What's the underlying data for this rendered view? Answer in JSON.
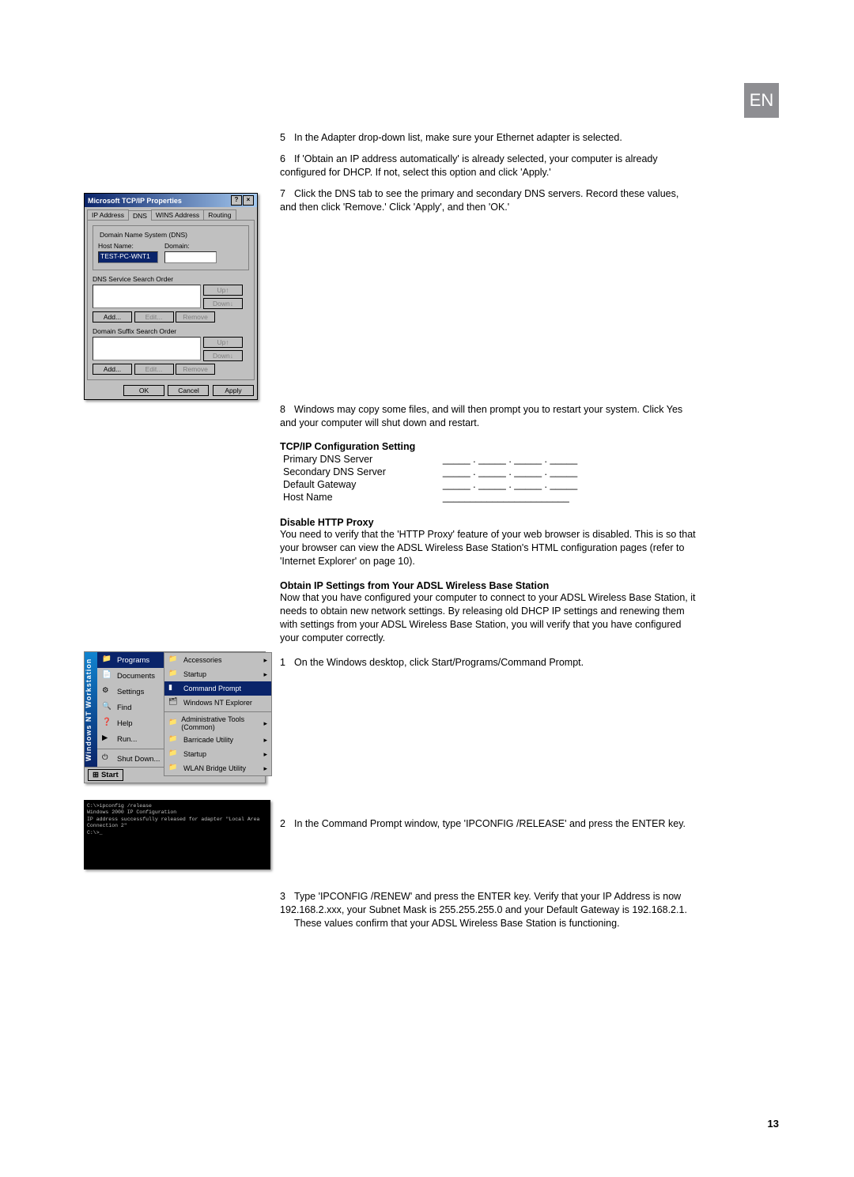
{
  "lang_tab": "EN",
  "page_number": "13",
  "steps_top": {
    "s5": "In the Adapter drop-down list, make sure your Ethernet adapter is selected.",
    "s6": "If 'Obtain an IP address automatically' is already selected, your computer is already configured for DHCP. If not, select this option and click 'Apply.'",
    "s7": "Click the DNS tab to see the primary and secondary DNS servers. Record these values, and then click 'Remove.' Click 'Apply', and then 'OK.'",
    "s8": "Windows may copy some files, and will then prompt you to restart your system. Click Yes and your computer will shut down and restart."
  },
  "tcpip_dialog": {
    "title": "Microsoft TCP/IP Properties",
    "tabs": [
      "IP Address",
      "DNS",
      "WINS Address",
      "Routing"
    ],
    "grp1": "Domain Name System (DNS)",
    "host_label": "Host Name:",
    "host_value": "TEST-PC-WNT1",
    "domain_label": "Domain:",
    "grp2": "DNS Service Search Order",
    "grp3": "Domain Suffix Search Order",
    "btn_up": "Up↑",
    "btn_down": "Down↓",
    "btn_add": "Add...",
    "btn_edit": "Edit...",
    "btn_remove": "Remove",
    "btn_ok": "OK",
    "btn_cancel": "Cancel",
    "btn_apply": "Apply"
  },
  "config_section": {
    "heading": "TCP/IP Configuration Setting",
    "rows": [
      "Primary DNS Server",
      "Secondary DNS Server",
      "Default Gateway",
      "Host Name"
    ],
    "blank": "_____ . _____ . _____ . _____",
    "blank_plain": "_______________________"
  },
  "proxy_section": {
    "heading": "Disable HTTP Proxy",
    "body": "You need to verify that the 'HTTP Proxy' feature of your web browser is disabled. This is so that your browser can view the ADSL Wireless Base Station's HTML configuration pages (refer to 'Internet Explorer' on page 10)."
  },
  "obtain_section": {
    "heading": "Obtain IP Settings from Your ADSL Wireless Base Station",
    "body": "Now that you have configured your computer to connect to your ADSL Wireless Base Station, it needs to obtain new network settings. By releasing old DHCP IP settings and renewing them with settings from your ADSL Wireless Base Station, you will verify that you have configured your computer correctly."
  },
  "steps_bottom": {
    "s1": "On the Windows desktop, click Start/Programs/Command Prompt.",
    "s2": "In the Command Prompt window, type 'IPCONFIG /RELEASE' and press the ENTER key.",
    "s3a": "Type 'IPCONFIG /RENEW' and press the ENTER key. Verify that your IP Address is now 192.168.2.xxx, your Subnet Mask is 255.255.255.0 and your Default Gateway is 192.168.2.1.",
    "s3b": "These values confirm that your ADSL Wireless Base Station is functioning."
  },
  "start_menu": {
    "side": "Windows NT Workstation",
    "items": [
      "Programs",
      "Documents",
      "Settings",
      "Find",
      "Help",
      "Run...",
      "Shut Down..."
    ],
    "sub_top": [
      "Accessories",
      "Startup",
      "Command Prompt",
      "Windows NT Explorer"
    ],
    "sub_bottom": [
      "Administrative Tools (Common)",
      "Barricade Utility",
      "Startup",
      "WLAN Bridge Utility"
    ],
    "start_btn": "Start"
  },
  "cmd_lines": [
    "C:\\>ipconfig /release",
    "",
    "Windows 2000 IP Configuration",
    "",
    "IP address successfully released for adapter \"Local Area Connection 2\"",
    "",
    "C:\\>_"
  ]
}
